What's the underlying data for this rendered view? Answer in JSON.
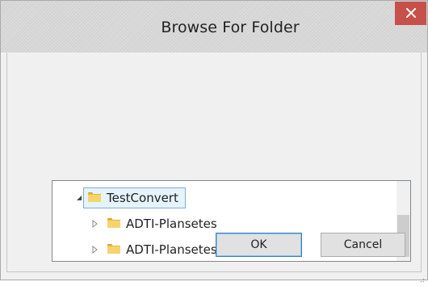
{
  "window": {
    "title": "Browse For Folder",
    "close_icon": "close-icon"
  },
  "tree": {
    "items": [
      {
        "label": "TestConvert",
        "expanded": true,
        "selected": true,
        "icon": "folder-icon"
      },
      {
        "label": "ADTI-Plansetes",
        "expanded": false,
        "selected": false,
        "icon": "folder-icon"
      },
      {
        "label": "ADTI-Plansetes_converted",
        "expanded": false,
        "selected": false,
        "icon": "folder-icon"
      }
    ]
  },
  "buttons": {
    "ok_label": "OK",
    "cancel_label": "Cancel"
  },
  "colors": {
    "close_button": "#c7504a",
    "selection_bg": "#e5f3fb",
    "selection_border": "#84acd3",
    "default_button_border": "#3c7fb1"
  }
}
